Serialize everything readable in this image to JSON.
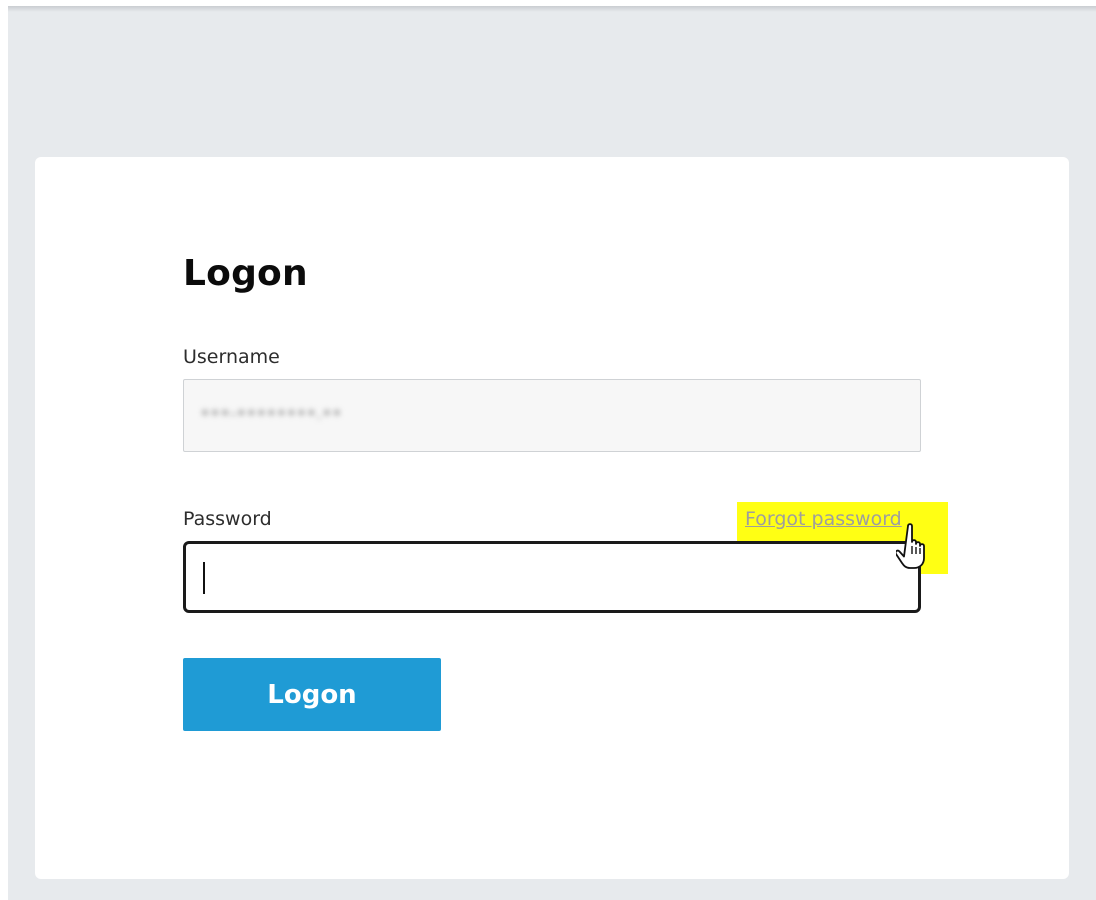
{
  "login": {
    "title": "Logon",
    "username_label": "Username",
    "username_value": "•••-••••••••.••",
    "password_label": "Password",
    "forgot_password_link": "Forgot password",
    "logon_button": "Logon"
  },
  "colors": {
    "page_background": "#e7eaed",
    "card_background": "#ffffff",
    "button_background": "#1f9bd5",
    "highlight": "#ffff14"
  },
  "icons": {
    "cursor": "hand-pointer-icon"
  }
}
